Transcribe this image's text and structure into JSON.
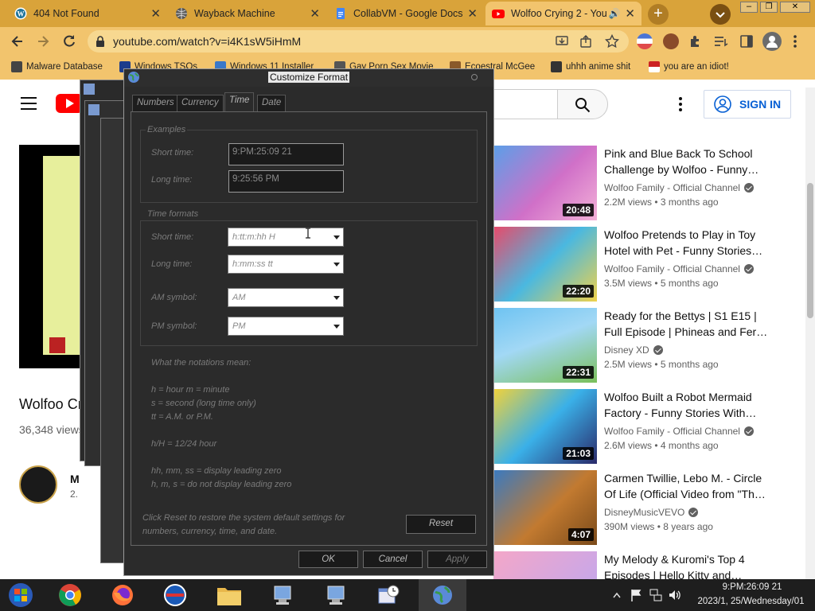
{
  "browser": {
    "tabs": [
      {
        "label": "404 Not Found",
        "icon": "wordpress-icon"
      },
      {
        "label": "Wayback Machine",
        "icon": "globe-icon"
      },
      {
        "label": "CollabVM - Google Docs",
        "icon": "docs-icon"
      },
      {
        "label": "Wolfoo Crying 2 - You",
        "icon": "youtube-icon"
      }
    ],
    "url": "youtube.com/watch?v=i4K1sW5iHmM",
    "bookmarks": [
      "Malware Database",
      "Windows TSOs",
      "Windows 11 Installer",
      "Gay Porn Sex Movie",
      "Ecoestral McGee",
      "uhhh anime shit",
      "you are an idiot!"
    ]
  },
  "youtube": {
    "sign_in": "SIGN IN",
    "video_title": "Wolfoo Cr",
    "views": "36,348 views",
    "channel_initial": "M",
    "subs_partial": "2.",
    "related": [
      {
        "title": "Pink and Blue Back To School Challenge by Wolfoo - Funny…",
        "channel": "Wolfoo Family - Official Channel",
        "meta": "2.2M views • 3 months ago",
        "duration": "20:48"
      },
      {
        "title": "Wolfoo Pretends to Play in Toy Hotel with Pet - Funny Stories…",
        "channel": "Wolfoo Family - Official Channel",
        "meta": "3.5M views • 5 months ago",
        "duration": "22:20"
      },
      {
        "title": "Ready for the Bettys | S1 E15 | Full Episode | Phineas and Fer…",
        "channel": "Disney XD",
        "meta": "2.5M views • 5 months ago",
        "duration": "22:31"
      },
      {
        "title": "Wolfoo Built a Robot Mermaid Factory - Funny Stories With…",
        "channel": "Wolfoo Family - Official Channel",
        "meta": "2.6M views • 4 months ago",
        "duration": "21:03"
      },
      {
        "title": "Carmen Twillie, Lebo M. - Circle Of Life (Official Video from \"Th…",
        "channel": "DisneyMusicVEVO",
        "meta": "390M views • 8 years ago",
        "duration": "4:07"
      },
      {
        "title": "My Melody & Kuromi's Top 4 Episodes | Hello Kitty and…",
        "channel": "",
        "meta": "",
        "duration": ""
      }
    ]
  },
  "dialog": {
    "title": "Customize Format",
    "tabs": [
      "Numbers",
      "Currency",
      "Time",
      "Date"
    ],
    "active_tab": "Time",
    "examples_legend": "Examples",
    "short_time_label": "Short time:",
    "short_time_example": "9:PM:25:09 21",
    "long_time_label": "Long time:",
    "long_time_example": "9:25:56 PM",
    "formats_legend": "Time formats",
    "short_time_format": "h:tt:m:hh H",
    "long_time_format": "h:mm:ss tt",
    "am_label": "AM symbol:",
    "am_value": "AM",
    "pm_label": "PM symbol:",
    "pm_value": "PM",
    "notes": [
      "What the notations mean:",
      "h = hour   m = minute",
      "s = second (long time only)",
      "tt = A.M. or P.M.",
      "h/H = 12/24 hour",
      "hh, mm, ss = display leading zero",
      "h, m, s = do not display leading zero"
    ],
    "reset_note_line1": "Click Reset to restore the system default settings for",
    "reset_note_line2": "numbers, currency, time, and date.",
    "reset": "Reset",
    "ok": "OK",
    "cancel": "Cancel",
    "apply": "Apply"
  },
  "taskbar": {
    "clock_time": "9:PM:26:09 21",
    "clock_date": "2023/1, 25/Wednesday/01"
  },
  "colors": {
    "chrome_frame": "#d9a33a",
    "chrome_toolbar": "#f2c46d",
    "dialog_bg": "#2b2b2b",
    "sign_in_blue": "#065fd4"
  }
}
